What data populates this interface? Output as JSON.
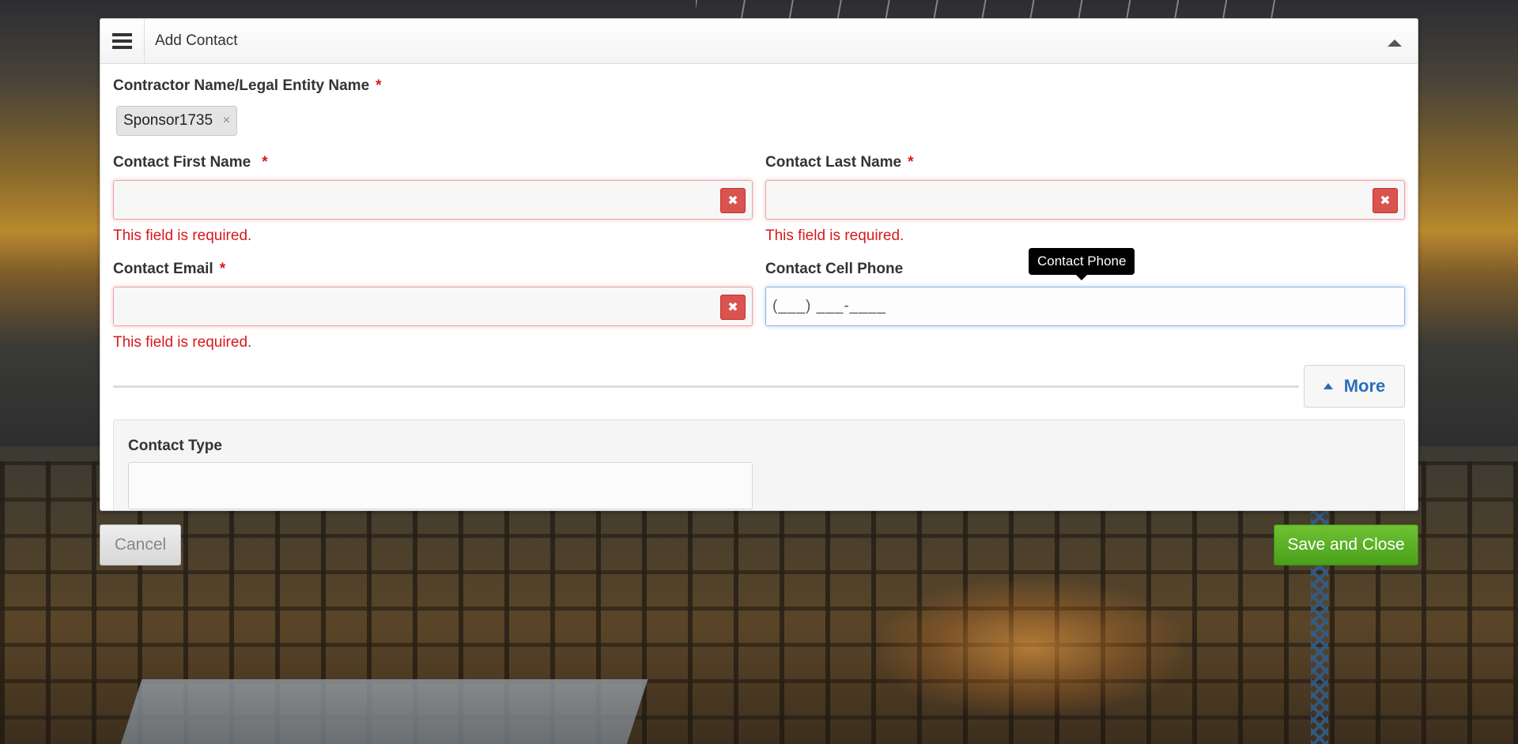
{
  "modal": {
    "title": "Add Contact",
    "menu_icon": "hamburger-icon",
    "collapse_icon": "caret-up-icon"
  },
  "fields": {
    "contractor": {
      "label": "Contractor Name/Legal Entity Name",
      "required_mark": "*",
      "selected_tag": "Sponsor1735",
      "tag_remove": "×"
    },
    "first_name": {
      "label": "Contact First Name",
      "required_mark": "*",
      "value": "",
      "error": "This field is required.",
      "clear_icon": "✖"
    },
    "last_name": {
      "label": "Contact Last Name",
      "required_mark": "*",
      "value": "",
      "error": "This field is required.",
      "clear_icon": "✖"
    },
    "email": {
      "label": "Contact Email",
      "required_mark": "*",
      "value": "",
      "error": "This field is required.",
      "clear_icon": "✖"
    },
    "cell_phone": {
      "label": "Contact Cell Phone",
      "value": "(___) ___-____",
      "tooltip": "Contact Phone"
    },
    "contact_type": {
      "label": "Contact Type",
      "value": ""
    }
  },
  "more_toggle": {
    "label": "More",
    "icon": "caret-up-icon"
  },
  "footer": {
    "cancel_label": "Cancel",
    "save_label": "Save and Close"
  },
  "colors": {
    "required": "#d7191c",
    "error": "#d7191c",
    "link_blue": "#2a6ebb",
    "save_green": "#5cb226",
    "clear_red": "#d9534f"
  }
}
